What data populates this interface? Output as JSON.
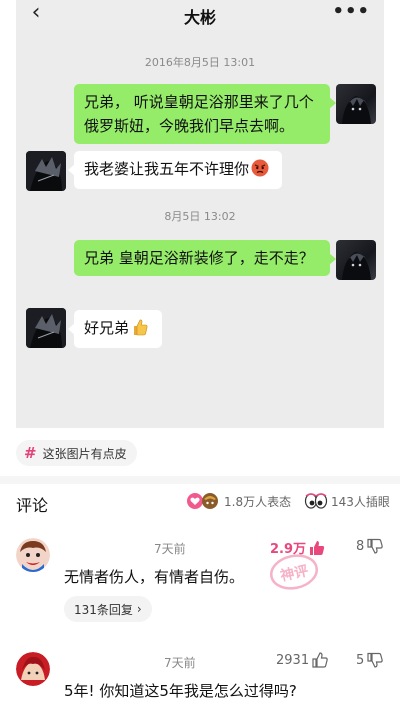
{
  "chat": {
    "title": "大彬",
    "back_icon": "chevron-left-icon",
    "more_icon": "more-dots-icon",
    "more_label": "•••",
    "messages": [
      {
        "type": "timestamp",
        "text": "2016年8月5日 13:01"
      },
      {
        "type": "outgoing",
        "text": "兄弟， 听说皇朝足浴那里来了几个俄罗斯妞，今晚我们早点去啊。"
      },
      {
        "type": "incoming",
        "text": "我老婆让我五年不许理你",
        "emoji": "angry-face-emoji"
      },
      {
        "type": "timestamp",
        "text": "8月5日 13:02"
      },
      {
        "type": "outgoing",
        "text": "兄弟 皇朝足浴新装修了，走不走？"
      },
      {
        "type": "incoming",
        "text": "好兄弟",
        "emoji": "thumbs-up-emoji"
      }
    ]
  },
  "tag": {
    "icon": "hashtag-icon",
    "label": "这张图片有点皮"
  },
  "comments_header": {
    "title": "评论",
    "reactions_label": "1.8万人表态",
    "glasses_label": "143人插眼"
  },
  "comments": [
    {
      "time": "7天前",
      "likes": "2.9万",
      "dislikes": "8",
      "text": "无情者伤人，有情者自伤。",
      "replies_label": "131条回复",
      "stamp_label": "神评",
      "colors": {
        "likes": "#e8487c"
      }
    },
    {
      "time": "7天前",
      "likes": "2931",
      "dislikes": "5",
      "text": "5年! 你知道这5年我是怎么过得吗?"
    }
  ],
  "colors": {
    "outgoing_bubble": "#95ec69",
    "incoming_bubble": "#ffffff",
    "accent": "#e8487c"
  }
}
